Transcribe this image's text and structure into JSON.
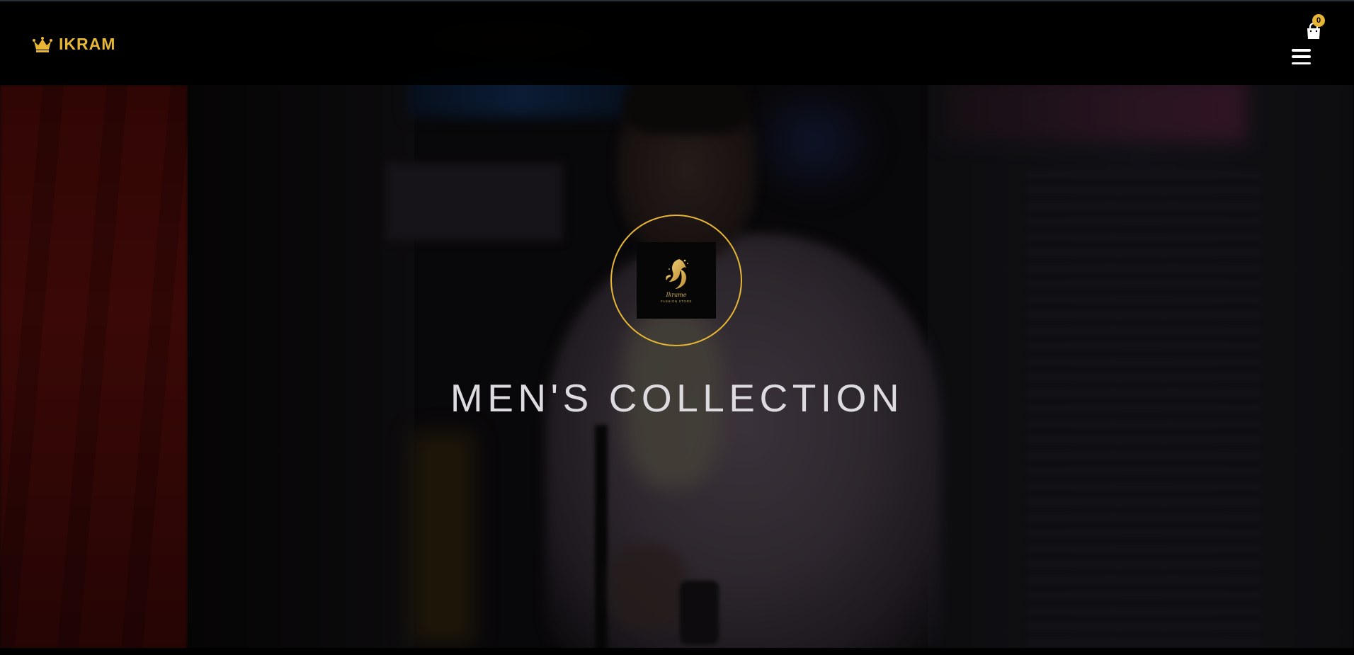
{
  "header": {
    "brand_name": "IKRAM",
    "brand_icon": "crown-icon",
    "cart_icon": "shopping-bag-icon",
    "cart_count": "0",
    "menu_icon": "hamburger-menu-icon"
  },
  "hero": {
    "logo_script": "Ikrame",
    "logo_subtitle": "FASHION STORE",
    "title": "MEN'S COLLECTION"
  },
  "colors": {
    "accent": "#e6b634",
    "header_bg": "#000000",
    "title_text": "#dedbe0"
  }
}
